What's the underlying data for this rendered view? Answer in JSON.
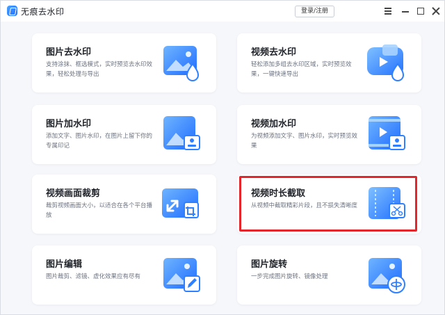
{
  "app": {
    "title": "无痕去水印"
  },
  "header": {
    "login_label": "登录/注册"
  },
  "cards": [
    {
      "title": "图片去水印",
      "desc": "支持涂抹、框选模式，实时预览去水印效果，轻松处理与导出",
      "icon": "image-drop-icon"
    },
    {
      "title": "视频去水印",
      "desc": "轻松添加多组去水印区域，实时预览效果，一键快速导出",
      "icon": "video-drop-icon"
    },
    {
      "title": "图片加水印",
      "desc": "添加文字、图片水印，在图片上留下你的专属印记",
      "icon": "image-stamp-icon"
    },
    {
      "title": "视频加水印",
      "desc": "为视频添加文字、图片水印，实时预览效果",
      "icon": "video-stamp-icon"
    },
    {
      "title": "视频画面裁剪",
      "desc": "裁剪视频画面大小，以适合在各个平台播放",
      "icon": "crop-icon"
    },
    {
      "title": "视频时长截取",
      "desc": "从视频中截取精彩片段，且不损失清晰度",
      "icon": "video-cut-icon"
    },
    {
      "title": "图片编辑",
      "desc": "图片裁剪、滤镜、虚化效果应有尽有",
      "icon": "image-edit-icon"
    },
    {
      "title": "图片旋转",
      "desc": "一步完成图片旋转、镜像处理",
      "icon": "image-rotate-icon"
    }
  ],
  "colors": {
    "accent": "#2f80ff",
    "highlight": "#e3262b"
  }
}
